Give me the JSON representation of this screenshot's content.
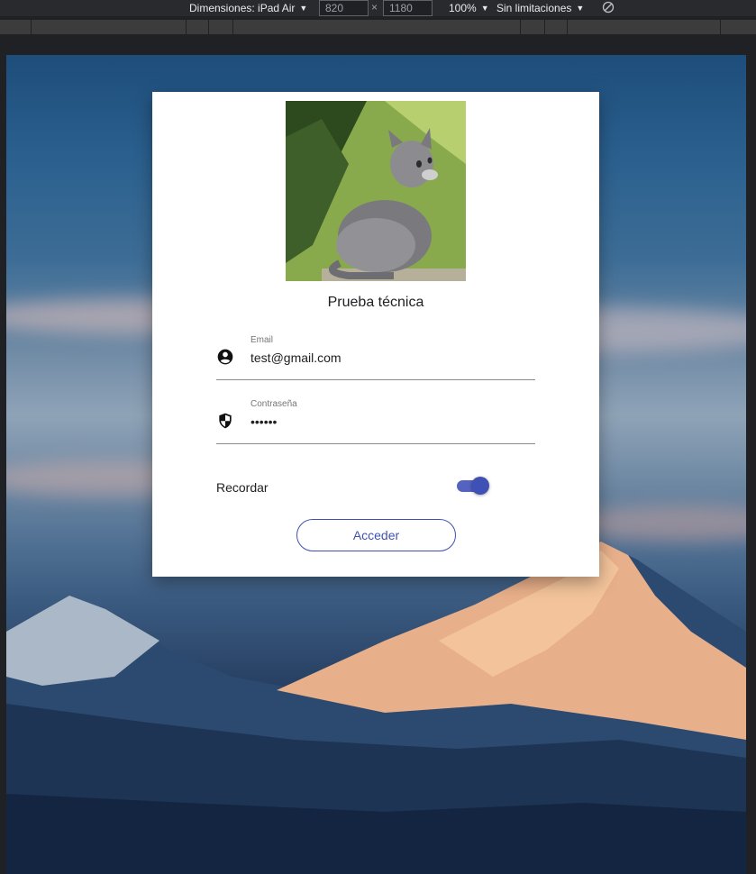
{
  "devtools": {
    "dimensions_label": "Dimensiones: iPad Air",
    "width_value": "820",
    "height_value": "1180",
    "times_symbol": "×",
    "zoom": "100%",
    "throttling": "Sin limitaciones",
    "dropdown_glyph": "▼",
    "rotate_icon": "rotate-icon"
  },
  "card": {
    "title": "Prueba técnica",
    "image_icon": "kitten-photo",
    "email": {
      "label": "Email",
      "value": "test@gmail.com",
      "icon": "account-circle-icon"
    },
    "password": {
      "label": "Contraseña",
      "value": "123456",
      "icon": "security-shield-icon"
    },
    "remember": {
      "label": "Recordar",
      "checked": true
    },
    "submit_label": "Acceder"
  },
  "colors": {
    "accent": "#3f51b5",
    "card_bg": "#ffffff",
    "toolbar_bg": "#292a2d"
  }
}
